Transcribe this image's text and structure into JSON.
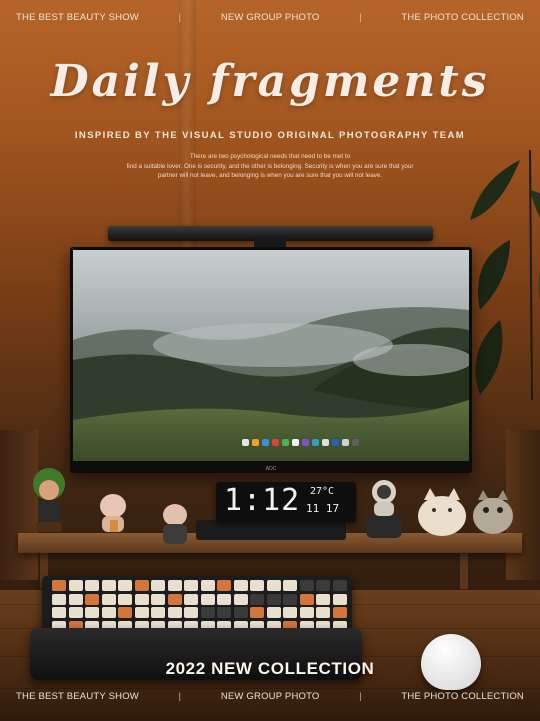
{
  "nav_top": [
    "THE BEST BEAUTY SHOW",
    "NEW GROUP PHOTO",
    "THE PHOTO COLLECTION"
  ],
  "nav_separator": "|",
  "title": "Daily fragments",
  "subtitle": "INSPIRED BY THE VISUAL STUDIO ORIGINAL PHOTOGRAPHY TEAM",
  "body_lines": [
    "There are two psychological needs that need to be met to",
    "find a suitable lover. One is security, and the other is belonging. Security is when you are sure that your",
    "partner will not leave, and belonging is when you are sure that you will not leave."
  ],
  "monitor_brand": "AOC",
  "clock": {
    "time": "1:12",
    "temp": "27°C",
    "date": "11 17"
  },
  "collection": "2022 NEW COLLECTION",
  "nav_bottom": [
    "THE BEST BEAUTY SHOW",
    "NEW GROUP PHOTO",
    "THE PHOTO COLLECTION"
  ],
  "colors": {
    "wall": "#a2561f",
    "desk": "#4a2a12",
    "text": "#f4ebe0",
    "key_orange": "#d4753a",
    "key_cream": "#e8e0cf"
  }
}
